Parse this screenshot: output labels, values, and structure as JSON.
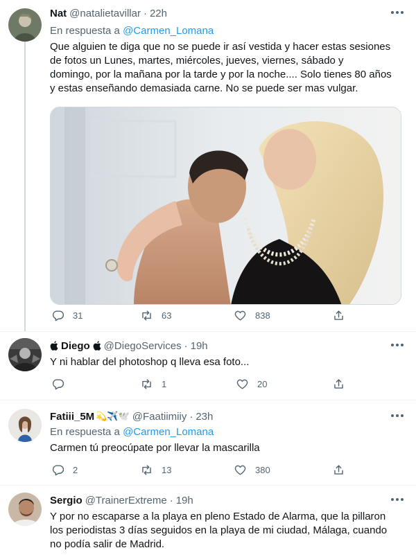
{
  "tweets": [
    {
      "name": "Nat",
      "handle": "@natalietavillar",
      "time": "22h",
      "reply_prefix": "En respuesta a ",
      "reply_mention": "@Carmen_Lomana",
      "text": "Que alguien te diga que no se puede ir así vestida y hacer estas sesiones\nde fotos un Lunes, martes,  miércoles, jueves, viernes,  sábado y\ndomingo, por la mañana por la tarde y por la noche.... Solo tienes 80 años\ny estas enseñando demasiada carne. No se puede ser mas vulgar.",
      "replies": "31",
      "retweets": "63",
      "likes": "838"
    },
    {
      "name_prefix": "",
      "name": "Diego",
      "name_suffix": "",
      "handle": "@DiegoServices",
      "time": "19h",
      "text": "Y ni hablar del photoshop q lleva esa foto...",
      "replies": "",
      "retweets": "1",
      "likes": "20"
    },
    {
      "name": "Fatiii_5M",
      "name_emoji": "💫✈️🕊️",
      "handle": "@Faatiimiiy",
      "time": "23h",
      "reply_prefix": "En respuesta a ",
      "reply_mention": "@Carmen_Lomana",
      "text": "Carmen tú preocúpate por llevar la mascarilla",
      "replies": "2",
      "retweets": "13",
      "likes": "380"
    },
    {
      "name": "Sergio",
      "handle": "@TrainerExtreme",
      "time": "19h",
      "text": "Y por no escaparse a la playa en pleno Estado de Alarma, que la pillaron\nlos periodistas 3 días seguidos en la playa de mi ciudad, Málaga, cuando\nno podía salir de Madrid."
    }
  ],
  "separator": "·",
  "colors": {
    "link": "#1d9bf0",
    "secondary_text": "#536471",
    "primary_text": "#0f1419",
    "thread_line": "#cfd9de"
  },
  "icons": [
    "reply-icon",
    "retweet-icon",
    "like-icon",
    "share-icon",
    "more-icon",
    "apple-icon"
  ]
}
